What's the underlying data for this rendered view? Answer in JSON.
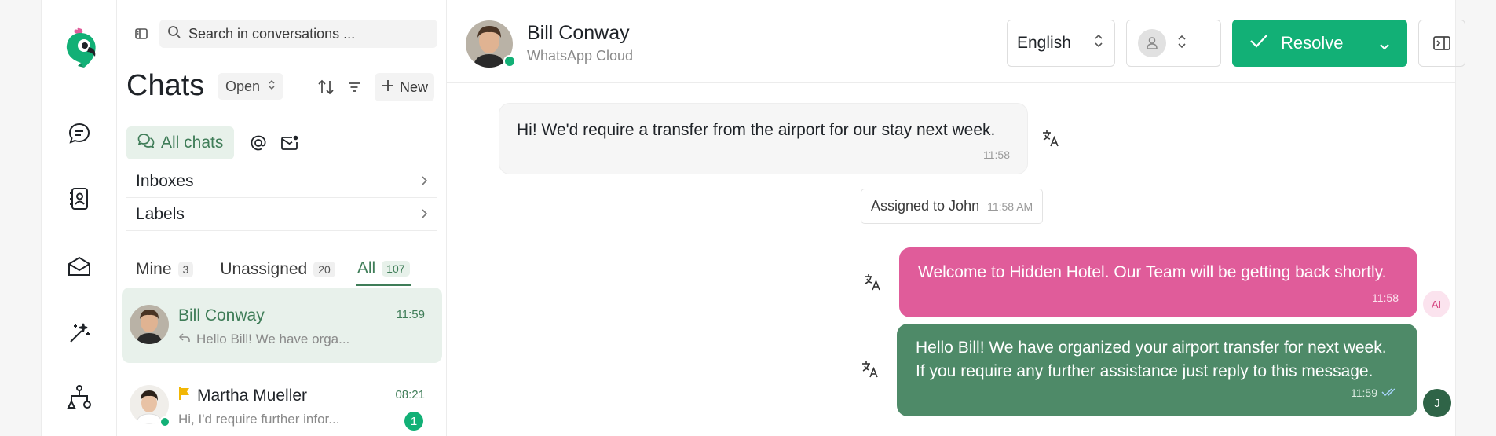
{
  "search": {
    "placeholder": "Search in conversations ..."
  },
  "list": {
    "title": "Chats",
    "status_filter": "Open",
    "new_label": "New",
    "all_chats_label": "All chats",
    "sections": [
      {
        "label": "Inboxes"
      },
      {
        "label": "Labels"
      }
    ],
    "tabs": [
      {
        "label": "Mine",
        "count": "3"
      },
      {
        "label": "Unassigned",
        "count": "20"
      },
      {
        "label": "All",
        "count": "107"
      }
    ],
    "conversations": [
      {
        "name": "Bill Conway",
        "preview": "Hello Bill! We have orga...",
        "time": "11:59",
        "active": true
      },
      {
        "name": "Martha Mueller",
        "preview": "Hi, I'd require further infor...",
        "time": "08:21",
        "unread": "1",
        "flagged": true
      }
    ]
  },
  "header": {
    "contact_name": "Bill Conway",
    "channel": "WhatsApp Cloud",
    "language": "English",
    "resolve_label": "Resolve"
  },
  "messages": {
    "incoming": {
      "text": "Hi! We'd require a transfer from the airport for our stay next week.",
      "time": "11:58"
    },
    "activity": {
      "text": "Assigned to John",
      "time": "11:58 AM"
    },
    "ai_reply": {
      "text": "Welcome to Hidden Hotel. Our Team will be getting back shortly.",
      "time": "11:58",
      "badge": "AI"
    },
    "agent_reply": {
      "line1": "Hello Bill! We have organized your airport transfer for next week.",
      "line2": "If you require any further assistance just reply to this message.",
      "time": "11:59",
      "badge": "J"
    }
  },
  "colors": {
    "brand_green": "#12b076",
    "active_green": "#3f7d58",
    "agent_bubble": "#4e8a68",
    "ai_bubble": "#e05c9a",
    "flag": "#f2b705"
  },
  "icons": {
    "rail": [
      "parrot-logo-icon",
      "chat-bubble-icon",
      "contacts-icon",
      "inbox-envelope-icon",
      "magic-wand-icon",
      "org-chart-icon"
    ]
  }
}
